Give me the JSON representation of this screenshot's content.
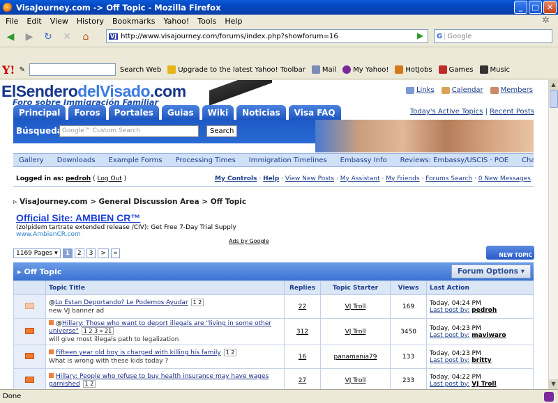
{
  "window": {
    "title": "VisaJourney.com -> Off Topic - Mozilla Firefox"
  },
  "menu": [
    "File",
    "Edit",
    "View",
    "History",
    "Bookmarks",
    "Yahoo!",
    "Tools",
    "Help"
  ],
  "address": {
    "url": "http://www.visajourney.com/forums/index.php?showforum=16",
    "search_placeholder": "Google"
  },
  "yahoo_toolbar": {
    "search_label": "Search Web",
    "items": [
      "Upgrade to the latest Yahoo! Toolbar",
      "Mail",
      "My Yahoo!",
      "HotJobs",
      "Games",
      "Music"
    ]
  },
  "site": {
    "logo_part1": "ElSendero",
    "logo_part2": "delVisado",
    "logo_part3": ".com",
    "tagline": "Foro sobre Immigración Familiar",
    "top_links": [
      "Links",
      "Calendar",
      "Members"
    ],
    "tabs": [
      "Principal",
      "Foros",
      "Portales",
      "Guias",
      "Wiki",
      "Noticias",
      "Visa FAQ"
    ],
    "right_links": [
      "Today's Active Topics",
      "Recent Posts"
    ],
    "search_label": "Búsqueda",
    "search_placeholder": "Google™ Custom Search",
    "search_button": "Search",
    "subnav": [
      "Gallery",
      "Downloads",
      "Example Forms",
      "Processing Times",
      "Immigration Timelines",
      "Embassy Info",
      "Reviews: Embassy/USCIS · POE",
      "Chat"
    ]
  },
  "login": {
    "prefix": "Logged in as:",
    "user": "pedroh",
    "logout": "Log Out",
    "controls": [
      "My Controls",
      "Help",
      "View New Posts",
      "My Assistant",
      "My Friends",
      "Forums Search",
      "0 New Messages"
    ]
  },
  "breadcrumb": "VisaJourney.com > General Discussion Area > Off Topic",
  "ad": {
    "title": "Official Site: AMBIEN CR™",
    "desc": "(zolpidem tartrate extended release /CIV): Get Free 7-Day Trial Supply",
    "url": "www.AmbienCR.com",
    "ads_by": "Ads by Google"
  },
  "pager": {
    "total": "1169 Pages",
    "pages": [
      "1",
      "2",
      "3"
    ],
    "next": ">",
    "last": "»"
  },
  "new_topic": "NEW TOPIC",
  "forum": {
    "name": "Off Topic",
    "options": "Forum Options",
    "columns": [
      "Topic Title",
      "Replies",
      "Topic Starter",
      "Views",
      "Last Action"
    ],
    "topics": [
      {
        "prefix": "@",
        "title": "Lo Estan Deportando? Le Podemos Ayudar",
        "pages": "1 2",
        "desc": "new VJ banner ad",
        "replies": "22",
        "starter": "VJ Troll",
        "views": "169",
        "date": "Today, 04:24 PM",
        "lastby_label": "Last post by:",
        "lastby": "pedroh"
      },
      {
        "prefix": "@",
        "title": "Hillary: Those who want to deport illegals are \"living in some other universe\"",
        "pages": "1 2 3 » 21",
        "desc": "will give most illegals path to legalization",
        "replies": "312",
        "starter": "VJ Troll",
        "views": "3450",
        "date": "Today, 04:23 PM",
        "lastby_label": "Last post by:",
        "lastby": "maviwaro"
      },
      {
        "prefix": "",
        "title": "Fifteen year old boy is charged with killing his family",
        "pages": "1 2",
        "desc": "What is wrong with these kids today ?",
        "replies": "16",
        "starter": "panamania79",
        "views": "133",
        "date": "Today, 04:23 PM",
        "lastby_label": "Last post by:",
        "lastby": "britty"
      },
      {
        "prefix": "",
        "title": "Hillary: People who refuse to buy health insurance may have wages garnished",
        "pages": "1 2",
        "desc": "",
        "replies": "27",
        "starter": "VJ Troll",
        "views": "233",
        "date": "Today, 04:22 PM",
        "lastby_label": "Last post by:",
        "lastby": "VJ Troll"
      }
    ]
  },
  "status": "Done"
}
